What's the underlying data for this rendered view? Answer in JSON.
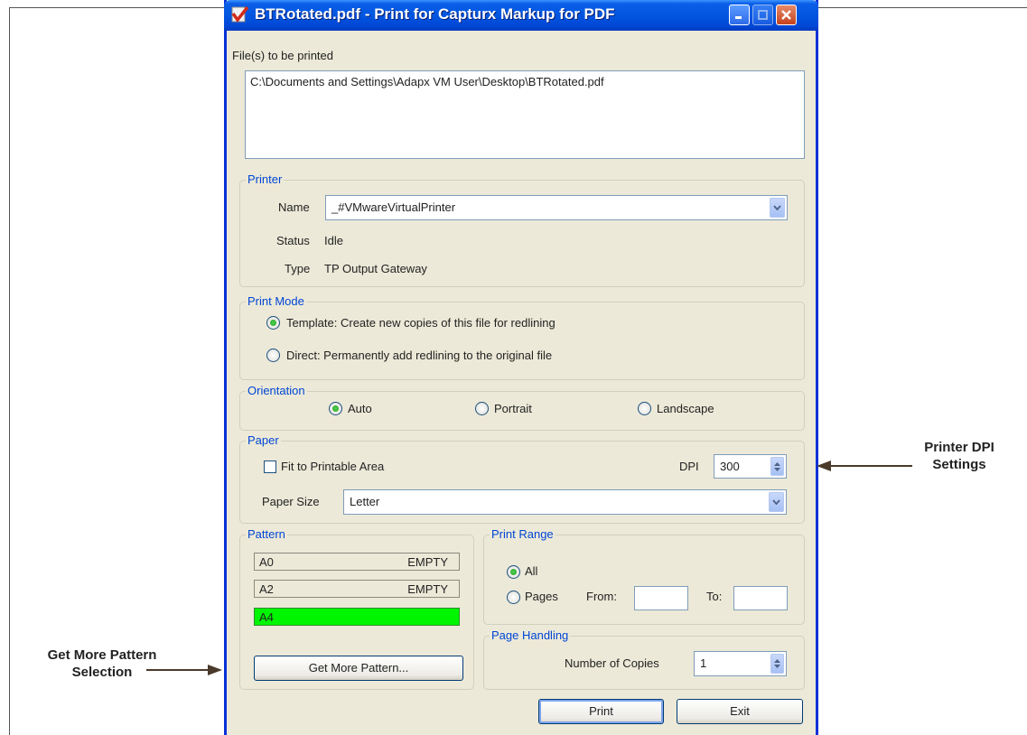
{
  "window": {
    "title": "BTRotated.pdf - Print for Capturx Markup for PDF",
    "accent": "#0054e3",
    "icon": "capturx-checkmark-icon",
    "controls": [
      "minimize-icon",
      "maximize-icon",
      "close-icon"
    ]
  },
  "files": {
    "label": "File(s) to be printed",
    "items": [
      "C:\\Documents and Settings\\Adapx VM User\\Desktop\\BTRotated.pdf"
    ]
  },
  "printer": {
    "legend": "Printer",
    "name_label": "Name",
    "name_value": "_#VMwareVirtualPrinter",
    "status_label": "Status",
    "status_value": "Idle",
    "type_label": "Type",
    "type_value": "TP Output Gateway"
  },
  "print_mode": {
    "legend": "Print Mode",
    "options": [
      {
        "label": "Template: Create new copies of this file for redlining",
        "selected": true
      },
      {
        "label": "Direct: Permanently add redlining to the original file",
        "selected": false
      }
    ]
  },
  "orientation": {
    "legend": "Orientation",
    "options": [
      {
        "label": "Auto",
        "selected": true
      },
      {
        "label": "Portrait",
        "selected": false
      },
      {
        "label": "Landscape",
        "selected": false
      }
    ]
  },
  "paper": {
    "legend": "Paper",
    "fit_label": "Fit to Printable Area",
    "fit_checked": false,
    "dpi_label": "DPI",
    "dpi_value": "300",
    "size_label": "Paper Size",
    "size_value": "Letter"
  },
  "pattern": {
    "legend": "Pattern",
    "items": [
      {
        "name": "A0",
        "status": "EMPTY",
        "selected": false
      },
      {
        "name": "A2",
        "status": "EMPTY",
        "selected": false
      },
      {
        "name": "A4",
        "status": "",
        "selected": true
      }
    ],
    "selected_color": "#00f000",
    "more_button": "Get More Pattern..."
  },
  "print_range": {
    "legend": "Print Range",
    "all_label": "All",
    "all_selected": true,
    "pages_label": "Pages",
    "from_label": "From:",
    "from_value": "",
    "to_label": "To:",
    "to_value": ""
  },
  "page_handling": {
    "legend": "Page Handling",
    "copies_label": "Number of Copies",
    "copies_value": "1"
  },
  "buttons": {
    "print": "Print",
    "exit": "Exit"
  },
  "annotations": {
    "dpi_line1": "Printer DPI",
    "dpi_line2": "Settings",
    "pattern_line1": "Get More Pattern",
    "pattern_line2": "Selection"
  }
}
